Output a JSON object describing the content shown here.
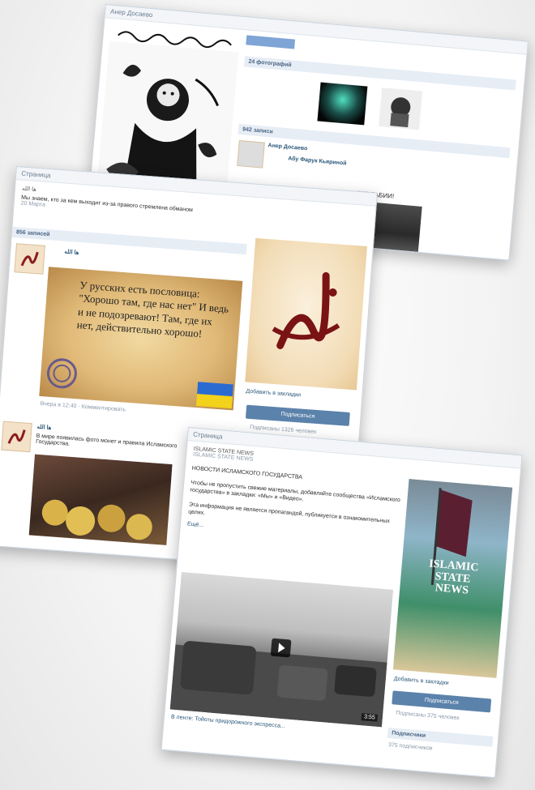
{
  "card1": {
    "title": "Анер Досаево",
    "photos_header": "24 фотографий",
    "wall_header": "942 записи",
    "post_author": "Анер Досаево",
    "repost_author": "Абу Фарук Кьяриной",
    "right_snippet": "ЖЕ ЛАБИИ!"
  },
  "card2": {
    "head": "Страница",
    "group_name": "ها الله",
    "status_line": "Мы знаем, кто за кем выходит из-за правого стремлена обманом",
    "status_line2": "20 Марта",
    "wall_header": "856 записей",
    "post1_author": "ها الله",
    "post1_quote": "У русских есть пословица: \"Хорошо там, где нас нет\" И ведь и не подозревают! Там, где их нет, действительно хорошо!",
    "post1_meta": "Вчера в 12:40",
    "post1_reply": "Комментировать",
    "post2_author": "ها الله",
    "post2_text": "В мире появилась фото монет и правила Исламского Государства.",
    "add_to_bookmarks": "Добавить в закладки",
    "subscribe": "Подписаться",
    "subscribers": "Подписаны 1326 человек"
  },
  "card3": {
    "head": "Страница",
    "name": "ISLAMIC STATE NEWS",
    "subtitle": "ISLAMIC STATE NEWS",
    "section": "НОВОСТИ ИСЛАМСКОГО ГОСУДАРСТВА",
    "body1": "Чтобы не пропустить свежие материалы, добавляйте сообщества «Исламского государства» в закладки: «Мы» и «Видео».",
    "body2": "Эта информация не является пропагандой, публикуется в ознакомительных целях.",
    "more": "Ещё...",
    "poster_line1": "ISLAMIC",
    "poster_line2": "STATE",
    "poster_line3": "NEWS",
    "video_duration": "3:55",
    "video_caption": "В ленте: Тойоты придорожного экспресса...",
    "add_to_bookmarks": "Добавить в закладки",
    "subscribe": "Подписаться",
    "subscribers": "Подписаны 375 человек",
    "links_header": "Подписчики",
    "links_count": "375 подписчиков"
  }
}
